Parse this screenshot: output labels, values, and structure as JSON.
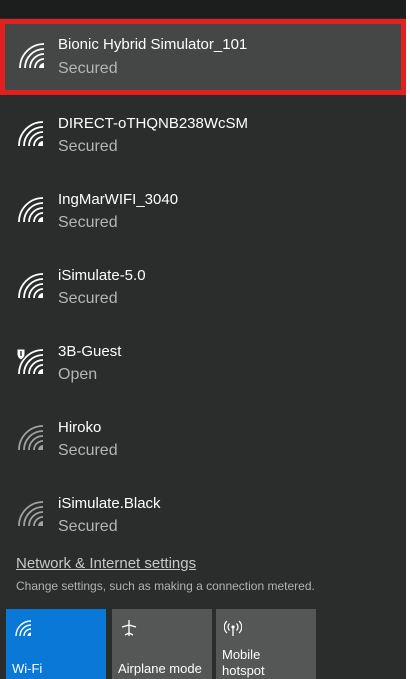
{
  "networks": [
    {
      "name": "Bionic Hybrid Simulator_101",
      "status": "Secured",
      "icon": "wifi-signal-icon"
    },
    {
      "name": "DIRECT-oTHQNB238WcSM",
      "status": "Secured",
      "icon": "wifi-signal-icon"
    },
    {
      "name": "IngMarWIFI_3040",
      "status": "Secured",
      "icon": "wifi-signal-icon"
    },
    {
      "name": "iSimulate-5.0",
      "status": "Secured",
      "icon": "wifi-signal-icon"
    },
    {
      "name": "3B-Guest",
      "status": "Open",
      "icon": "wifi-open-shield-icon"
    },
    {
      "name": "Hiroko",
      "status": "Secured",
      "icon": "wifi-weak-signal-icon"
    },
    {
      "name": "iSimulate.Black",
      "status": "Secured",
      "icon": "wifi-weak-signal-icon"
    }
  ],
  "settings": {
    "link": "Network & Internet settings",
    "description": "Change settings, such as making a connection metered."
  },
  "quick_actions": [
    {
      "label": "Wi-Fi",
      "icon": "wifi-icon",
      "state": "on"
    },
    {
      "label": "Airplane mode",
      "icon": "airplane-icon",
      "state": "off"
    },
    {
      "label_line1": "Mobile",
      "label_line2": "hotspot",
      "icon": "mobile-hotspot-icon",
      "state": "off"
    }
  ],
  "colors": {
    "panel_background": "#2b2c2c",
    "selected_background": "#454646",
    "selection_outline": "#e32020",
    "accent": "#0a78d6"
  }
}
